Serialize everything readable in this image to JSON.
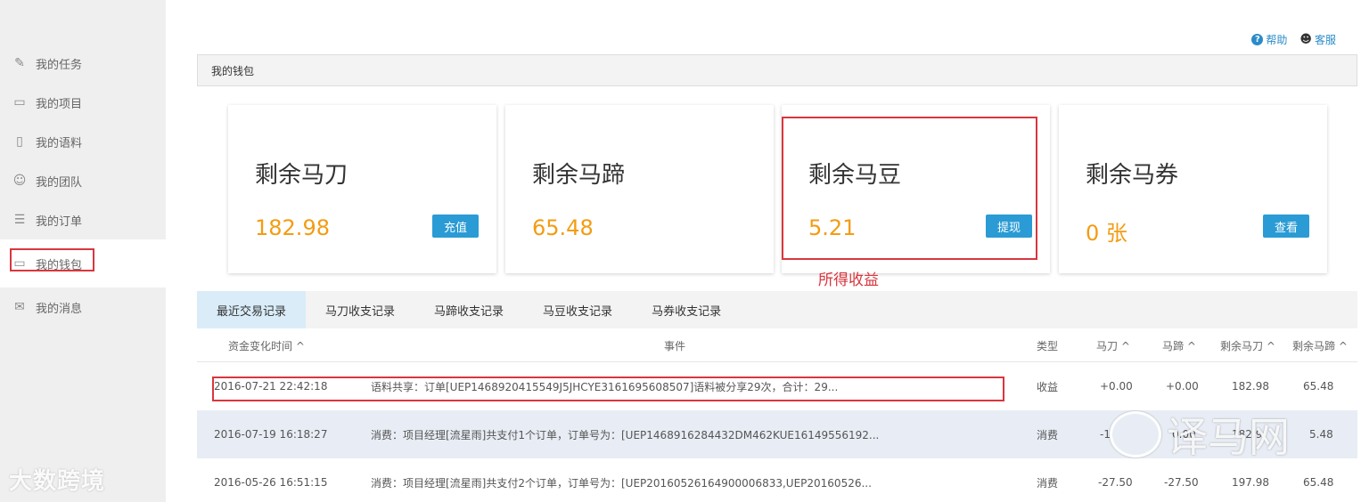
{
  "sidebar": {
    "items": [
      {
        "label": "我的任务",
        "icon": "edit-icon"
      },
      {
        "label": "我的项目",
        "icon": "folder-icon"
      },
      {
        "label": "我的语料",
        "icon": "book-icon"
      },
      {
        "label": "我的团队",
        "icon": "team-icon"
      },
      {
        "label": "我的订单",
        "icon": "list-icon"
      },
      {
        "label": "我的钱包",
        "icon": "wallet-icon"
      },
      {
        "label": "我的消息",
        "icon": "mail-icon"
      }
    ],
    "watermark": "大数跨境"
  },
  "top_links": {
    "help": "帮助",
    "service": "客服"
  },
  "breadcrumb": "我的钱包",
  "cards": [
    {
      "title": "剩余马刀",
      "value": "182.98",
      "button": "充值"
    },
    {
      "title": "剩余马蹄",
      "value": "65.48",
      "button": ""
    },
    {
      "title": "剩余马豆",
      "value": "5.21",
      "button": "提现"
    },
    {
      "title": "剩余马券",
      "value": "0 张",
      "button": "查看"
    }
  ],
  "annotation": "所得收益",
  "tabs": [
    "最近交易记录",
    "马刀收支记录",
    "马蹄收支记录",
    "马豆收支记录",
    "马券收支记录"
  ],
  "table": {
    "headers": {
      "time": "资金变化时间 ^",
      "event": "事件",
      "type": "类型",
      "madao": "马刀 ^",
      "mati": "马蹄 ^",
      "rest_madao": "剩余马刀 ^",
      "rest_mati": "剩余马蹄 ^"
    },
    "rows": [
      {
        "time": "2016-07-21 22:42:18",
        "event": "语料共享：订单[UEP1468920415549J5JHCYE3161695608507]语料被分享29次，合计：29...",
        "type": "收益",
        "madao": "+0.00",
        "mati": "+0.00",
        "rest_madao": "182.98",
        "rest_mati": "65.48"
      },
      {
        "time": "2016-07-19 16:18:27",
        "event": "消费：项目经理[流星雨]共支付1个订单，订单号为：[UEP1468916284432DM462KUE16149556192...",
        "type": "消费",
        "madao": "-1",
        "mati": "0.00",
        "rest_madao": "182.9",
        "rest_mati": "5.48"
      },
      {
        "time": "2016-05-26 16:51:15",
        "event": "消费：项目经理[流星雨]共支付2个订单，订单号为：[UEP20160526164900006833,UEP20160526...",
        "type": "消费",
        "madao": "-27.50",
        "mati": "-27.50",
        "rest_madao": "197.98",
        "rest_mati": "65.48"
      }
    ]
  },
  "watermark_right": "译马网"
}
